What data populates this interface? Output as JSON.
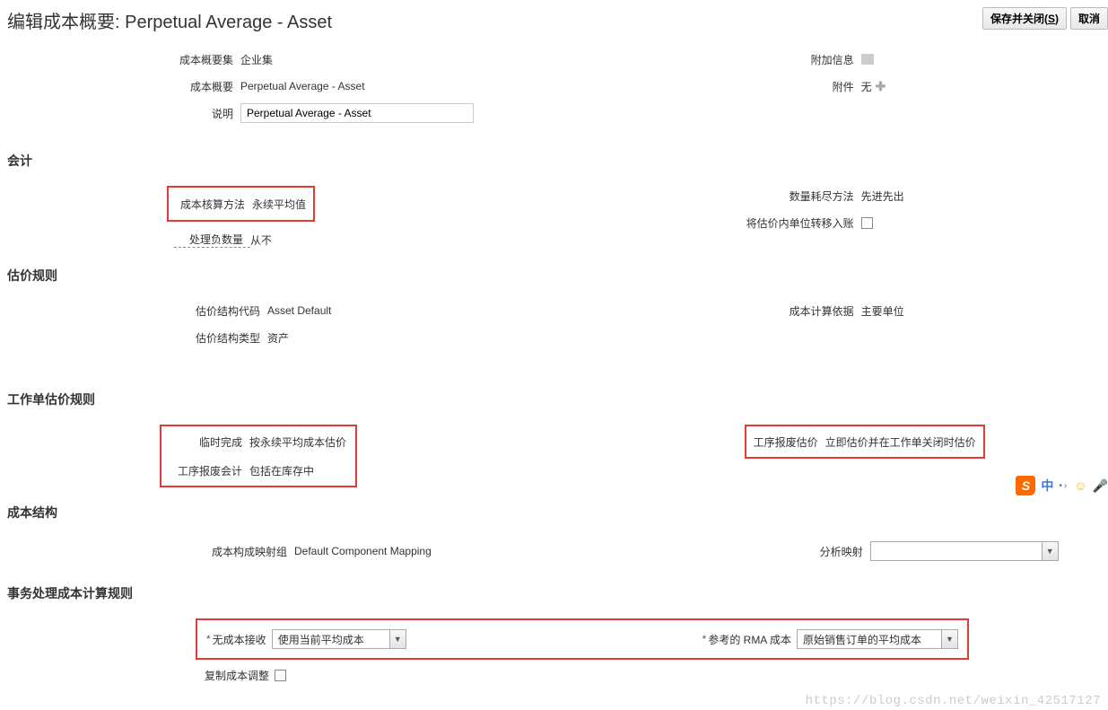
{
  "header": {
    "title": "编辑成本概要: Perpetual Average - Asset",
    "save_and_close": "保存并关闭(",
    "save_key": "S",
    "save_close_paren": ")",
    "cancel": "取消"
  },
  "topFields": {
    "profileSet": {
      "label": "成本概要集",
      "value": "企业集"
    },
    "profile": {
      "label": "成本概要",
      "value": "Perpetual Average - Asset"
    },
    "description": {
      "label": "说明",
      "value": "Perpetual Average - Asset"
    },
    "additionalInfo": {
      "label": "附加信息"
    },
    "attachments": {
      "label": "附件",
      "value": "无"
    }
  },
  "accounting": {
    "title": "会计",
    "method": {
      "label": "成本核算方法",
      "value": "永续平均值"
    },
    "negativeQty": {
      "label": "处理负数量",
      "value": "从不"
    },
    "depletion": {
      "label": "数量耗尽方法",
      "value": "先进先出"
    },
    "transferIn": {
      "label": "将估价内单位转移入账"
    }
  },
  "valuation": {
    "title": "估价规则",
    "structureCode": {
      "label": "估价结构代码",
      "value": "Asset Default"
    },
    "structureType": {
      "label": "估价结构类型",
      "value": "资产"
    },
    "calcBasis": {
      "label": "成本计算依据",
      "value": "主要单位"
    }
  },
  "workOrder": {
    "title": "工作单估价规则",
    "tempComplete": {
      "label": "临时完成",
      "value": "按永续平均成本估价"
    },
    "scrapAccounting": {
      "label": "工序报废会计",
      "value": "包括在库存中"
    },
    "scrapValuation": {
      "label": "工序报废估价",
      "value": "立即估价并在工作单关闭时估价"
    }
  },
  "costStructure": {
    "title": "成本结构",
    "mappingGroup": {
      "label": "成本构成映射组",
      "value": "Default Component Mapping"
    },
    "analysisMapping": {
      "label": "分析映射"
    }
  },
  "txnRules": {
    "title": "事务处理成本计算规则",
    "noCost": {
      "label": "无成本接收",
      "value": "使用当前平均成本"
    },
    "rmaCost": {
      "label": "参考的 RMA 成本",
      "value": "原始销售订单的平均成本"
    },
    "copyAdjust": {
      "label": "复制成本调整"
    }
  },
  "watermark": "https://blog.csdn.net/weixin_42517127"
}
